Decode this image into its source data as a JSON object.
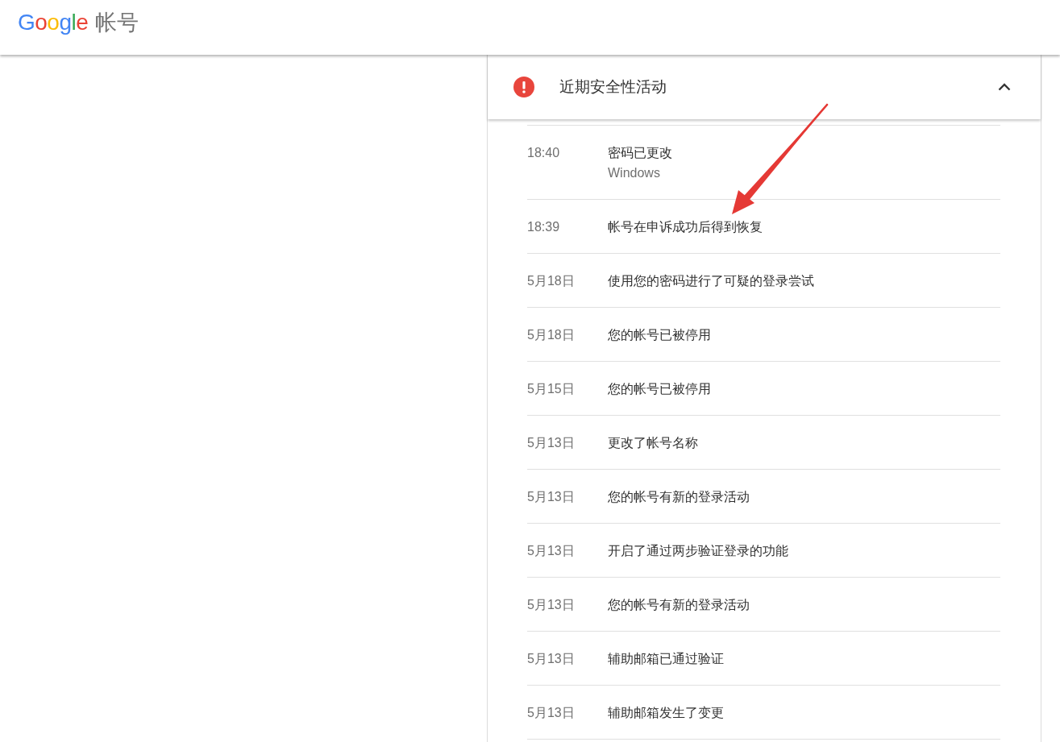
{
  "app_bar": {
    "logo": "Google",
    "title": "帐号"
  },
  "security_panel": {
    "alert": true,
    "title": "近期安全性活动",
    "expanded": true,
    "events": [
      {
        "time": "18:40",
        "description": "密码已更改",
        "detail": "Windows"
      },
      {
        "time": "18:39",
        "description": "帐号在申诉成功后得到恢复"
      },
      {
        "time": "5月18日",
        "description": "使用您的密码进行了可疑的登录尝试"
      },
      {
        "time": "5月18日",
        "description": "您的帐号已被停用"
      },
      {
        "time": "5月15日",
        "description": "您的帐号已被停用"
      },
      {
        "time": "5月13日",
        "description": "更改了帐号名称"
      },
      {
        "time": "5月13日",
        "description": "您的帐号有新的登录活动"
      },
      {
        "time": "5月13日",
        "description": "开启了通过两步验证登录的功能"
      },
      {
        "time": "5月13日",
        "description": "您的帐号有新的登录活动"
      },
      {
        "time": "5月13日",
        "description": "辅助邮箱已通过验证"
      },
      {
        "time": "5月13日",
        "description": "辅助邮箱发生了变更"
      }
    ]
  }
}
